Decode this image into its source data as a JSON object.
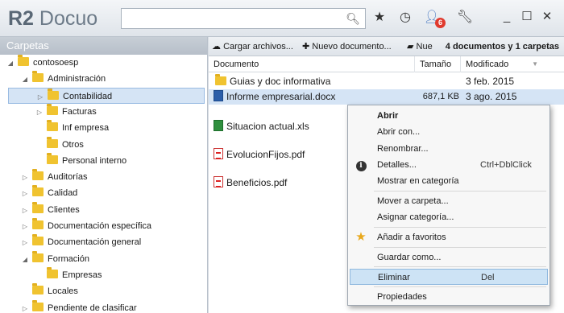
{
  "app": {
    "logo_prefix": "R2",
    "logo_name": "Docuo"
  },
  "search": {
    "placeholder": "",
    "icon": "search-icon"
  },
  "titlebar_icons": [
    "star-icon",
    "clock-icon",
    "users-icon",
    "wrench-icon"
  ],
  "notifications": {
    "count": "6"
  },
  "window_controls": {
    "minimize": "_",
    "maximize": "☐",
    "close": "✕"
  },
  "sidebar": {
    "title": "Carpetas",
    "tree": [
      {
        "label": "contosoesp",
        "level": 0,
        "expanded": true,
        "selected": false
      },
      {
        "label": "Administración",
        "level": 1,
        "expanded": true,
        "selected": false
      },
      {
        "label": "Contabilidad",
        "level": 2,
        "expanded": false,
        "selected": true
      },
      {
        "label": "Facturas",
        "level": 2,
        "expanded": false,
        "selected": false
      },
      {
        "label": "Inf empresa",
        "level": 2,
        "expanded": null,
        "selected": false
      },
      {
        "label": "Otros",
        "level": 2,
        "expanded": null,
        "selected": false
      },
      {
        "label": "Personal interno",
        "level": 2,
        "expanded": null,
        "selected": false
      },
      {
        "label": "Auditorías",
        "level": 1,
        "expanded": false,
        "selected": false
      },
      {
        "label": "Calidad",
        "level": 1,
        "expanded": false,
        "selected": false
      },
      {
        "label": "Clientes",
        "level": 1,
        "expanded": false,
        "selected": false
      },
      {
        "label": "Documentación específica",
        "level": 1,
        "expanded": false,
        "selected": false
      },
      {
        "label": "Documentación general",
        "level": 1,
        "expanded": false,
        "selected": false
      },
      {
        "label": "Formación",
        "level": 1,
        "expanded": true,
        "selected": false
      },
      {
        "label": "Empresas",
        "level": 2,
        "expanded": null,
        "selected": false
      },
      {
        "label": "Locales",
        "level": 1,
        "expanded": null,
        "selected": false
      },
      {
        "label": "Pendiente de clasificar",
        "level": 1,
        "expanded": false,
        "selected": false
      }
    ]
  },
  "toolbar": {
    "upload_label": "Cargar archivos...",
    "new_doc_label": "Nuevo documento...",
    "new_folder_label": "Nue",
    "count_label": "4 documentos y 1 carpetas"
  },
  "columns": {
    "name": "Documento",
    "size": "Tamaño",
    "modified": "Modificado"
  },
  "files": [
    {
      "name": "Guias y doc informativa",
      "type": "folder",
      "size": "",
      "modified": "3 feb. 2015"
    },
    {
      "name": "Informe empresarial.docx",
      "type": "word",
      "size": "687,1 KB",
      "modified": "3 ago. 2015"
    },
    {
      "name": "Situacion actual.xls",
      "type": "excel",
      "size": "",
      "modified": ""
    },
    {
      "name": "EvolucionFijos.pdf",
      "type": "pdf",
      "size": "",
      "modified": ""
    },
    {
      "name": "Beneficios.pdf",
      "type": "pdf",
      "size": "",
      "modified": ""
    }
  ],
  "context_menu": {
    "open": "Abrir",
    "open_with": "Abrir con...",
    "rename": "Renombrar...",
    "details": "Detalles...",
    "details_shortcut": "Ctrl+DblClick",
    "show_category": "Mostrar en categoría",
    "move_folder": "Mover a carpeta...",
    "assign_category": "Asignar categoría...",
    "add_favorites": "Añadir a favoritos",
    "save_as": "Guardar como...",
    "delete": "Eliminar",
    "delete_shortcut": "Del",
    "properties": "Propiedades"
  }
}
